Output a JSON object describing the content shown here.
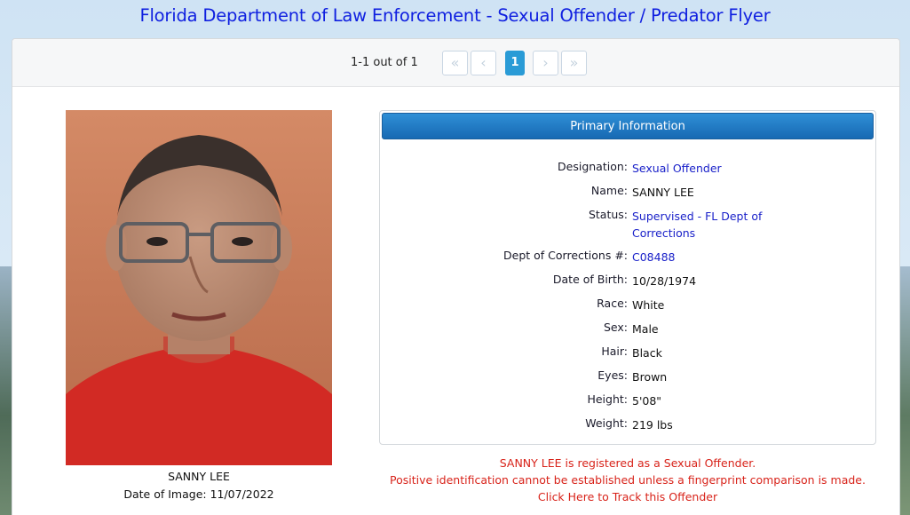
{
  "page": {
    "title": "Florida Department of Law Enforcement - Sexual Offender / Predator Flyer"
  },
  "pagination": {
    "count_label": "1-1 out of 1",
    "first_icon": "double-chevron-left-icon",
    "prev_icon": "chevron-left-icon",
    "current_page": "1",
    "next_icon": "chevron-right-icon",
    "last_icon": "double-chevron-right-icon"
  },
  "photo": {
    "name": "SANNY LEE",
    "date_label": "Date of Image: 11/07/2022"
  },
  "primary_info": {
    "header": "Primary Information",
    "fields": [
      {
        "label": "Designation:",
        "value": "Sexual Offender"
      },
      {
        "label": "Name:",
        "value": "SANNY LEE"
      },
      {
        "label": "Status:",
        "value_line1": "Supervised - FL Dept of",
        "value_line2": "Corrections"
      },
      {
        "label": "Dept of Corrections #:",
        "value": "C08488"
      },
      {
        "label": "Date of Birth:",
        "value": "10/28/1974"
      },
      {
        "label": "Race:",
        "value": "White"
      },
      {
        "label": "Sex:",
        "value": "Male"
      },
      {
        "label": "Hair:",
        "value": "Black"
      },
      {
        "label": "Eyes:",
        "value": "Brown"
      },
      {
        "label": "Height:",
        "value": "5'08\""
      },
      {
        "label": "Weight:",
        "value": "219 lbs"
      }
    ]
  },
  "notice": {
    "line1": "SANNY LEE is registered as a Sexual Offender.",
    "line2": "Positive identification cannot be established unless a fingerprint comparison is made.",
    "track_link": "Click Here to Track this Offender"
  },
  "colors": {
    "title": "#0f1fe0",
    "header_blue": "#1769b3",
    "link_blue": "#1a21c9",
    "notice_red": "#d8231a",
    "active_page": "#2a9bd6"
  }
}
